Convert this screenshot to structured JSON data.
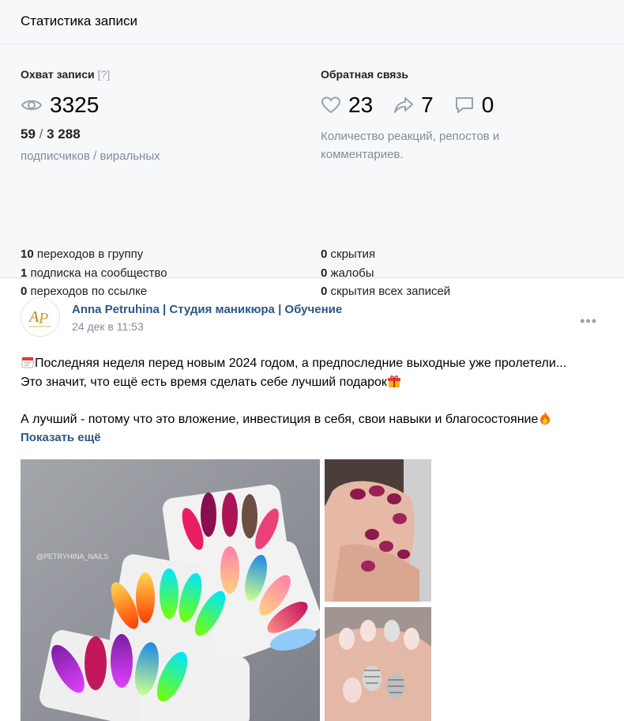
{
  "header": {
    "title": "Статистика записи"
  },
  "reach": {
    "title": "Охват записи",
    "help": "[?]",
    "views_icon": "eye-icon",
    "views": "3325",
    "subscribers": "59",
    "separator": "/",
    "viral": "3 288",
    "caption": "подписчиков / виральных"
  },
  "feedback": {
    "title": "Обратная связь",
    "likes_icon": "heart-icon",
    "likes": "23",
    "reposts_icon": "share-icon",
    "reposts": "7",
    "comments_icon": "comment-icon",
    "comments": "0",
    "description": "Количество реакций, репостов и комментариев."
  },
  "transitions": [
    {
      "count": "10",
      "label": "переходов в группу"
    },
    {
      "count": "1",
      "label": "подписка на сообщество"
    },
    {
      "count": "0",
      "label": "переходов по ссылке"
    }
  ],
  "negative": [
    {
      "count": "0",
      "label": "скрытия"
    },
    {
      "count": "0",
      "label": "жалобы"
    },
    {
      "count": "0",
      "label": "скрытия всех записей"
    }
  ],
  "post": {
    "author": "Anna Petruhina | Студия маникюра | Обучение",
    "date": "24 дек в 11:53",
    "line1": "Последняя неделя перед новым 2024 годом, а предпоследние выходные уже пролетели...",
    "line2": "Это значит, что ещё есть время сделать себе лучший подарок",
    "line3": "А лучший - потому что это вложение, инвестиция в себя, свои навыки и благосостояние",
    "show_more": "Показать ещё",
    "watermark": "@PETRYHINA_NAILS",
    "more_icon": "more-icon"
  },
  "colors": {
    "accent": "#2a5885",
    "muted": "#818c99"
  }
}
